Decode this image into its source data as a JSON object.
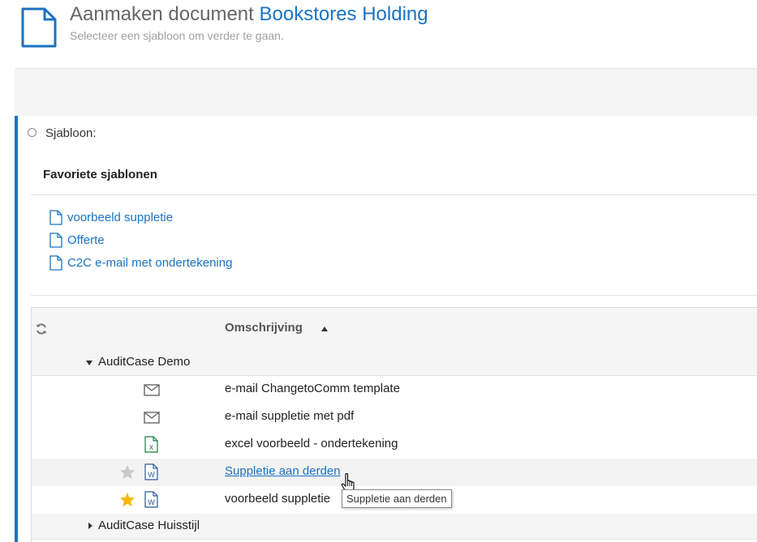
{
  "header": {
    "title": "Aanmaken document",
    "organization": "Bookstores Holding",
    "subtitle": "Selecteer een sjabloon om verder te gaan.",
    "icon": "document-icon"
  },
  "form": {
    "template_label": "Sjabloon:"
  },
  "favorites": {
    "title": "Favoriete sjablonen",
    "items": [
      {
        "label": "voorbeeld suppletie",
        "icon": "document-icon"
      },
      {
        "label": "Offerte",
        "icon": "document-icon"
      },
      {
        "label": "C2C e-mail met ondertekening",
        "icon": "document-icon"
      }
    ]
  },
  "grid": {
    "refresh_icon": "refresh-icon",
    "column_header": "Omschrijving",
    "sort": "ascending",
    "groups": [
      {
        "label": "AuditCase Demo",
        "expanded": true,
        "rows": [
          {
            "description": "e-mail ChangetoComm template",
            "type_icon": "email-icon",
            "favorite": null
          },
          {
            "description": "e-mail suppletie met pdf",
            "type_icon": "email-icon",
            "favorite": null
          },
          {
            "description": "excel voorbeeld - ondertekening",
            "type_icon": "excel-icon",
            "favorite": null
          },
          {
            "description": "Suppletie aan derden",
            "type_icon": "word-icon",
            "favorite": false
          },
          {
            "description": "voorbeeld suppletie",
            "type_icon": "word-icon",
            "favorite": true
          }
        ]
      },
      {
        "label": "AuditCase Huisstijl",
        "expanded": false,
        "rows": []
      }
    ]
  },
  "tooltip": {
    "text": "Suppletie aan derden"
  },
  "colors": {
    "accent": "#1a73c1",
    "favorite_star": "#f5b800",
    "inactive_star": "#c8c8c8",
    "excel": "#1f7a3f",
    "word": "#2b5797"
  }
}
